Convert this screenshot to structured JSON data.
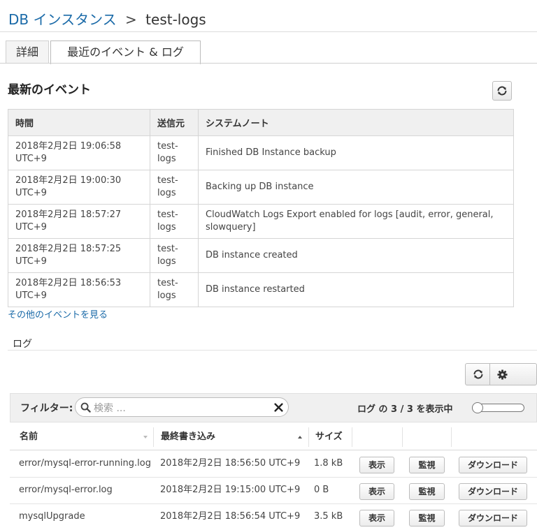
{
  "breadcrumb": {
    "parent": "DB インスタンス",
    "sep": ">",
    "current": "test-logs"
  },
  "tabs": [
    "詳細",
    "最近のイベント & ログ"
  ],
  "events": {
    "title": "最新のイベント",
    "headers": [
      "時間",
      "送信元",
      "システムノート"
    ],
    "rows": [
      {
        "time1": "2018年2月2日 19:06:58",
        "time2": "UTC+9",
        "src1": "test-",
        "src2": "logs",
        "note": "Finished DB Instance backup"
      },
      {
        "time1": "2018年2月2日 19:00:30",
        "time2": "UTC+9",
        "src1": "test-",
        "src2": "logs",
        "note": "Backing up DB instance"
      },
      {
        "time1": "2018年2月2日 18:57:27",
        "time2": "UTC+9",
        "src1": "test-",
        "src2": "logs",
        "note": "CloudWatch Logs Export enabled for logs [audit, error, general, slowquery]"
      },
      {
        "time1": "2018年2月2日 18:57:25",
        "time2": "UTC+9",
        "src1": "test-",
        "src2": "logs",
        "note": "DB instance created"
      },
      {
        "time1": "2018年2月2日 18:56:53",
        "time2": "UTC+9",
        "src1": "test-",
        "src2": "logs",
        "note": "DB instance restarted"
      }
    ],
    "more_link": "その他のイベントを見る"
  },
  "logs": {
    "title": "ログ",
    "filter_label": "フィルター:",
    "search_placeholder": "検索 ...",
    "count_text": "ログ の 3 / 3 を表示中",
    "headers": {
      "name": "名前",
      "last_written": "最終書き込み",
      "size": "サイズ"
    },
    "rows": [
      {
        "name": "error/mysql-error-running.log",
        "last_written": "2018年2月2日 18:56:50 UTC+9",
        "size": "1.8 kB"
      },
      {
        "name": "error/mysql-error.log",
        "last_written": "2018年2月2日 19:15:00 UTC+9",
        "size": "0 B"
      },
      {
        "name": "mysqlUpgrade",
        "last_written": "2018年2月2日 18:56:54 UTC+9",
        "size": "3.5 kB"
      }
    ],
    "actions": {
      "view": "表示",
      "watch": "監視",
      "download": "ダウンロード"
    }
  },
  "icons": {
    "refresh": "refresh-icon",
    "settings": "gear-icon",
    "search": "search-icon",
    "clear": "close-icon"
  },
  "colors": {
    "link": "#1a6aa8",
    "header_bg": "#f0f0f0"
  }
}
